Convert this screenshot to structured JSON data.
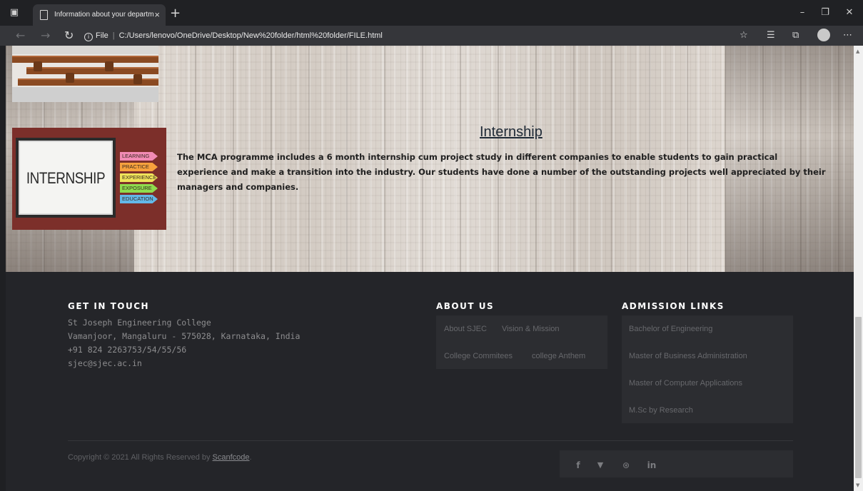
{
  "browser": {
    "tab_title": "Information about your departm",
    "tab_close": "×",
    "new_tab": "+",
    "address_prefix": "File",
    "url": "C:/Users/lenovo/OneDrive/Desktop/New%20folder/html%20folder/FILE.html",
    "window_controls": [
      "minimize-icon",
      "maximize-icon",
      "close-icon"
    ],
    "toolbar_icons": [
      "favorite-icon",
      "collections-list-icon",
      "collections-icon",
      "profile-icon",
      "more-icon"
    ]
  },
  "internship": {
    "image_text": "INTERNSHIP",
    "image_tags": [
      "LEARNING",
      "PRACTICE",
      "EXPERIENCE",
      "EXPOSURE",
      "EDUCATION"
    ],
    "heading": "Internship",
    "description": "The MCA programme includes a 6 month internship cum project study in different companies to enable students to gain practical experience and make a transition into the industry. Our students have done a number of the outstanding projects well appreciated by their managers and companies."
  },
  "footer": {
    "contact": {
      "heading": "GET IN TOUCH",
      "lines": [
        "St Joseph Engineering College",
        "Vamanjoor, Mangaluru - 575028, Karnataka, India",
        "+91 824 2263753/54/55/56",
        "sjec@sjec.ac.in"
      ]
    },
    "about": {
      "heading": "ABOUT US",
      "links": [
        "About SJEC",
        "Vision & Mission",
        "College Commitees",
        "college Anthem"
      ]
    },
    "admission": {
      "heading": "ADMISSION LINKS",
      "links": [
        "Bachelor of Engineering",
        "Master of Business Administration",
        "Master of Computer Applications",
        "M.Sc by Research"
      ]
    },
    "copyright_text": "Copyright © 2021 All Rights Reserved by ",
    "copyright_link": "Scanfcode",
    "copyright_end": ".",
    "social": [
      "f",
      "🐦",
      "⊛",
      "in"
    ],
    "social_names": [
      "facebook-icon",
      "twitter-icon",
      "dribbble-icon",
      "linkedin-icon"
    ]
  },
  "colors": {
    "footer_bg": "#242529",
    "footer_box": "#2c2d31",
    "heading_text": "#1f2a36"
  }
}
